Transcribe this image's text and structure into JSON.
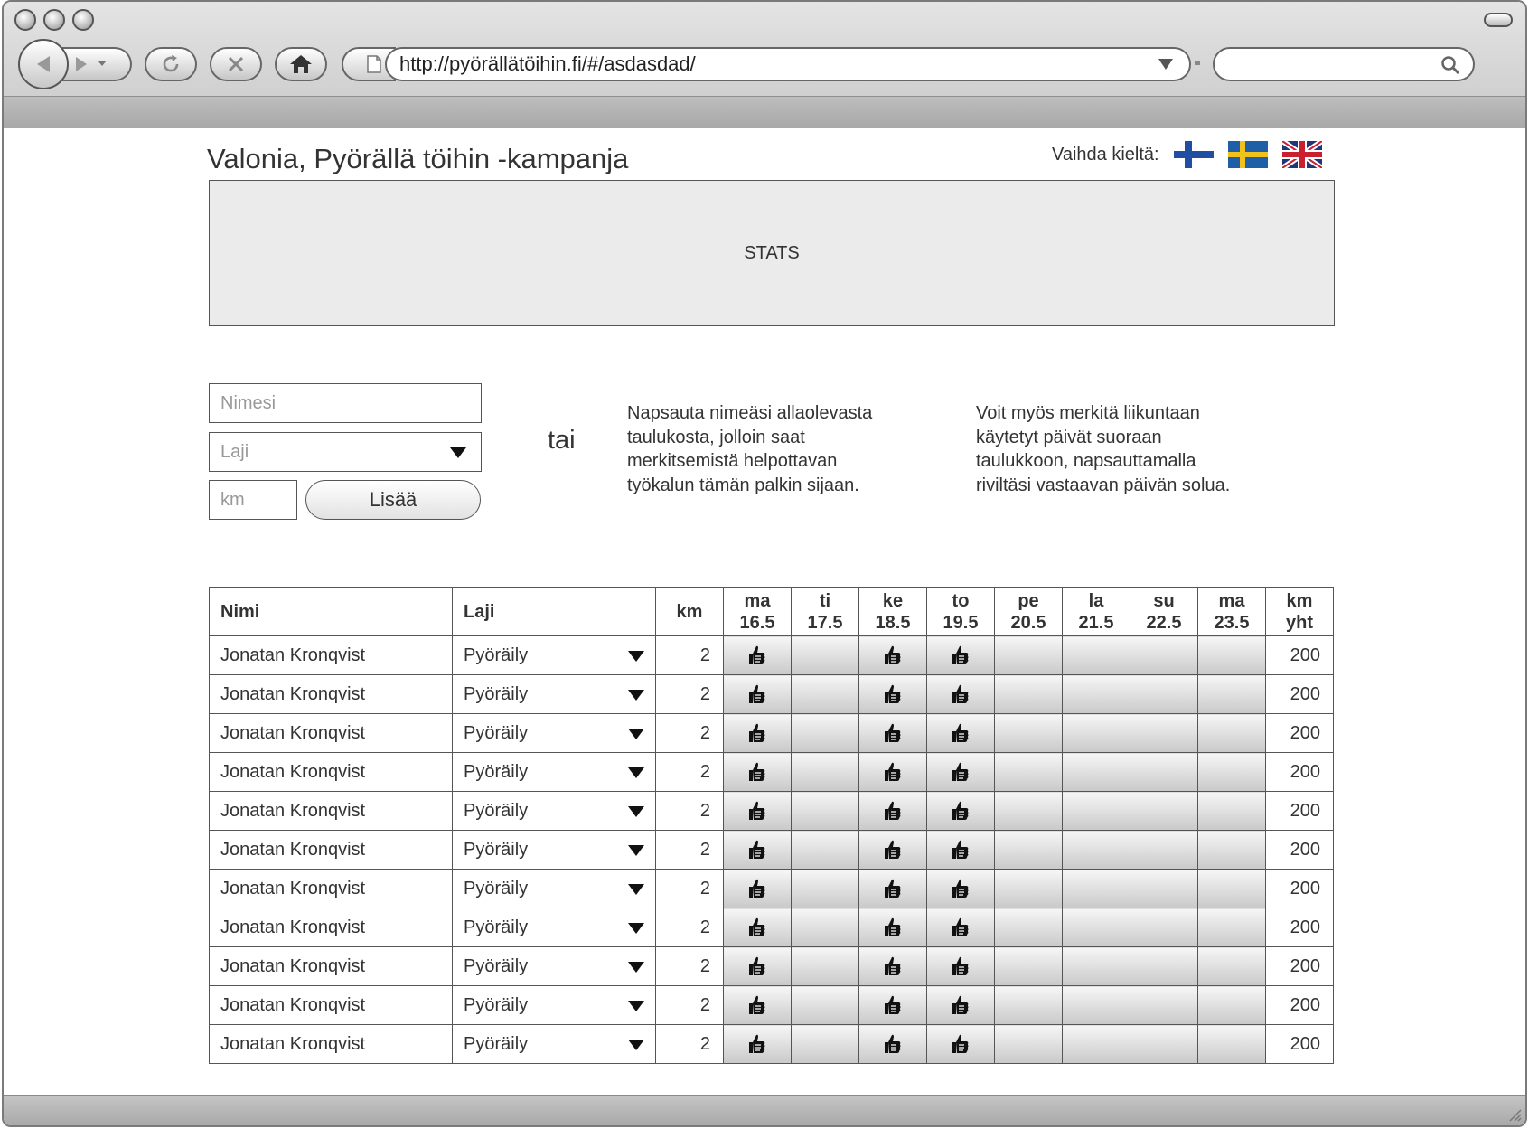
{
  "browser": {
    "url": "http://pyörällätöihin.fi/#/asdasdad/"
  },
  "page": {
    "title": "Valonia, Pyörällä töihin -kampanja",
    "lang_label": "Vaihda kieltä:",
    "flags": [
      "finnish-flag",
      "swedish-flag",
      "uk-flag"
    ]
  },
  "stats": {
    "label": "STATS"
  },
  "form": {
    "name_placeholder": "Nimesi",
    "laji_placeholder": "Laji",
    "km_placeholder": "km",
    "add_label": "Lisää"
  },
  "or_label": "tai",
  "info": {
    "left": "Napsauta nimeäsi allaolevasta taulukosta, jolloin saat merkitsemistä helpottavan työkalun tämän palkin sijaan.",
    "right": "Voit myös merkitä liikuntaan käytetyt päivät suoraan taulukkoon, napsauttamalla riviltäsi vastaavan päivän solua."
  },
  "table": {
    "headers": {
      "name": "Nimi",
      "laji": "Laji",
      "km": "km",
      "days": [
        {
          "d": "ma",
          "date": "16.5"
        },
        {
          "d": "ti",
          "date": "17.5"
        },
        {
          "d": "ke",
          "date": "18.5"
        },
        {
          "d": "to",
          "date": "19.5"
        },
        {
          "d": "pe",
          "date": "20.5"
        },
        {
          "d": "la",
          "date": "21.5"
        },
        {
          "d": "su",
          "date": "22.5"
        },
        {
          "d": "ma",
          "date": "23.5"
        }
      ],
      "total_1": "km",
      "total_2": "yht"
    },
    "rows": [
      {
        "name": "Jonatan Kronqvist",
        "laji": "Pyöräily",
        "km": "2",
        "days": [
          true,
          false,
          true,
          true,
          false,
          false,
          false,
          false
        ],
        "total": "200"
      },
      {
        "name": "Jonatan Kronqvist",
        "laji": "Pyöräily",
        "km": "2",
        "days": [
          true,
          false,
          true,
          true,
          false,
          false,
          false,
          false
        ],
        "total": "200"
      },
      {
        "name": "Jonatan Kronqvist",
        "laji": "Pyöräily",
        "km": "2",
        "days": [
          true,
          false,
          true,
          true,
          false,
          false,
          false,
          false
        ],
        "total": "200"
      },
      {
        "name": "Jonatan Kronqvist",
        "laji": "Pyöräily",
        "km": "2",
        "days": [
          true,
          false,
          true,
          true,
          false,
          false,
          false,
          false
        ],
        "total": "200"
      },
      {
        "name": "Jonatan Kronqvist",
        "laji": "Pyöräily",
        "km": "2",
        "days": [
          true,
          false,
          true,
          true,
          false,
          false,
          false,
          false
        ],
        "total": "200"
      },
      {
        "name": "Jonatan Kronqvist",
        "laji": "Pyöräily",
        "km": "2",
        "days": [
          true,
          false,
          true,
          true,
          false,
          false,
          false,
          false
        ],
        "total": "200"
      },
      {
        "name": "Jonatan Kronqvist",
        "laji": "Pyöräily",
        "km": "2",
        "days": [
          true,
          false,
          true,
          true,
          false,
          false,
          false,
          false
        ],
        "total": "200"
      },
      {
        "name": "Jonatan Kronqvist",
        "laji": "Pyöräily",
        "km": "2",
        "days": [
          true,
          false,
          true,
          true,
          false,
          false,
          false,
          false
        ],
        "total": "200"
      },
      {
        "name": "Jonatan Kronqvist",
        "laji": "Pyöräily",
        "km": "2",
        "days": [
          true,
          false,
          true,
          true,
          false,
          false,
          false,
          false
        ],
        "total": "200"
      },
      {
        "name": "Jonatan Kronqvist",
        "laji": "Pyöräily",
        "km": "2",
        "days": [
          true,
          false,
          true,
          true,
          false,
          false,
          false,
          false
        ],
        "total": "200"
      },
      {
        "name": "Jonatan Kronqvist",
        "laji": "Pyöräily",
        "km": "2",
        "days": [
          true,
          false,
          true,
          true,
          false,
          false,
          false,
          false
        ],
        "total": "200"
      }
    ]
  }
}
